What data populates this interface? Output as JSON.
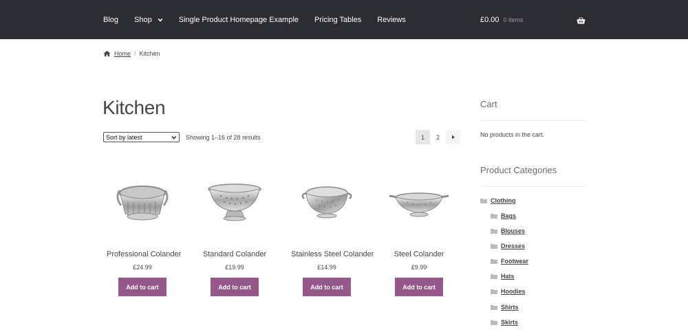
{
  "nav": {
    "items": [
      {
        "label": "Blog"
      },
      {
        "label": "Shop"
      },
      {
        "label": "Single Product Homepage Example"
      },
      {
        "label": "Pricing Tables"
      },
      {
        "label": "Reviews"
      }
    ],
    "cart_total": "£0.00",
    "cart_items": "0 items"
  },
  "breadcrumb": {
    "home": "Home",
    "separator": "/",
    "current": "Kitchen"
  },
  "page": {
    "title": "Kitchen",
    "sort_selected": "Sort by latest",
    "result_count": "Showing 1–16 of 28 results",
    "pages": [
      "1",
      "2"
    ],
    "current_page": "1"
  },
  "products": [
    {
      "name": "Professional Colander",
      "price": "£24.99",
      "button": "Add to cart"
    },
    {
      "name": "Standard Colander",
      "price": "£19.99",
      "button": "Add to cart"
    },
    {
      "name": "Stainless Steel Colander",
      "price": "£14.99",
      "button": "Add to cart"
    },
    {
      "name": "Steel Colander",
      "price": "£9.99",
      "button": "Add to cart"
    }
  ],
  "sidebar": {
    "cart_title": "Cart",
    "cart_empty": "No products in the cart.",
    "categories_title": "Product Categories",
    "categories": [
      {
        "label": "Clothing"
      },
      {
        "label": "Bags"
      },
      {
        "label": "Blouses"
      },
      {
        "label": "Dresses"
      },
      {
        "label": "Footwear"
      },
      {
        "label": "Hats"
      },
      {
        "label": "Hoodies"
      },
      {
        "label": "Shirts"
      },
      {
        "label": "Skirts"
      }
    ]
  },
  "colors": {
    "header_bg": "#2c2d33",
    "button_bg": "#96588a",
    "text": "#43454b"
  }
}
